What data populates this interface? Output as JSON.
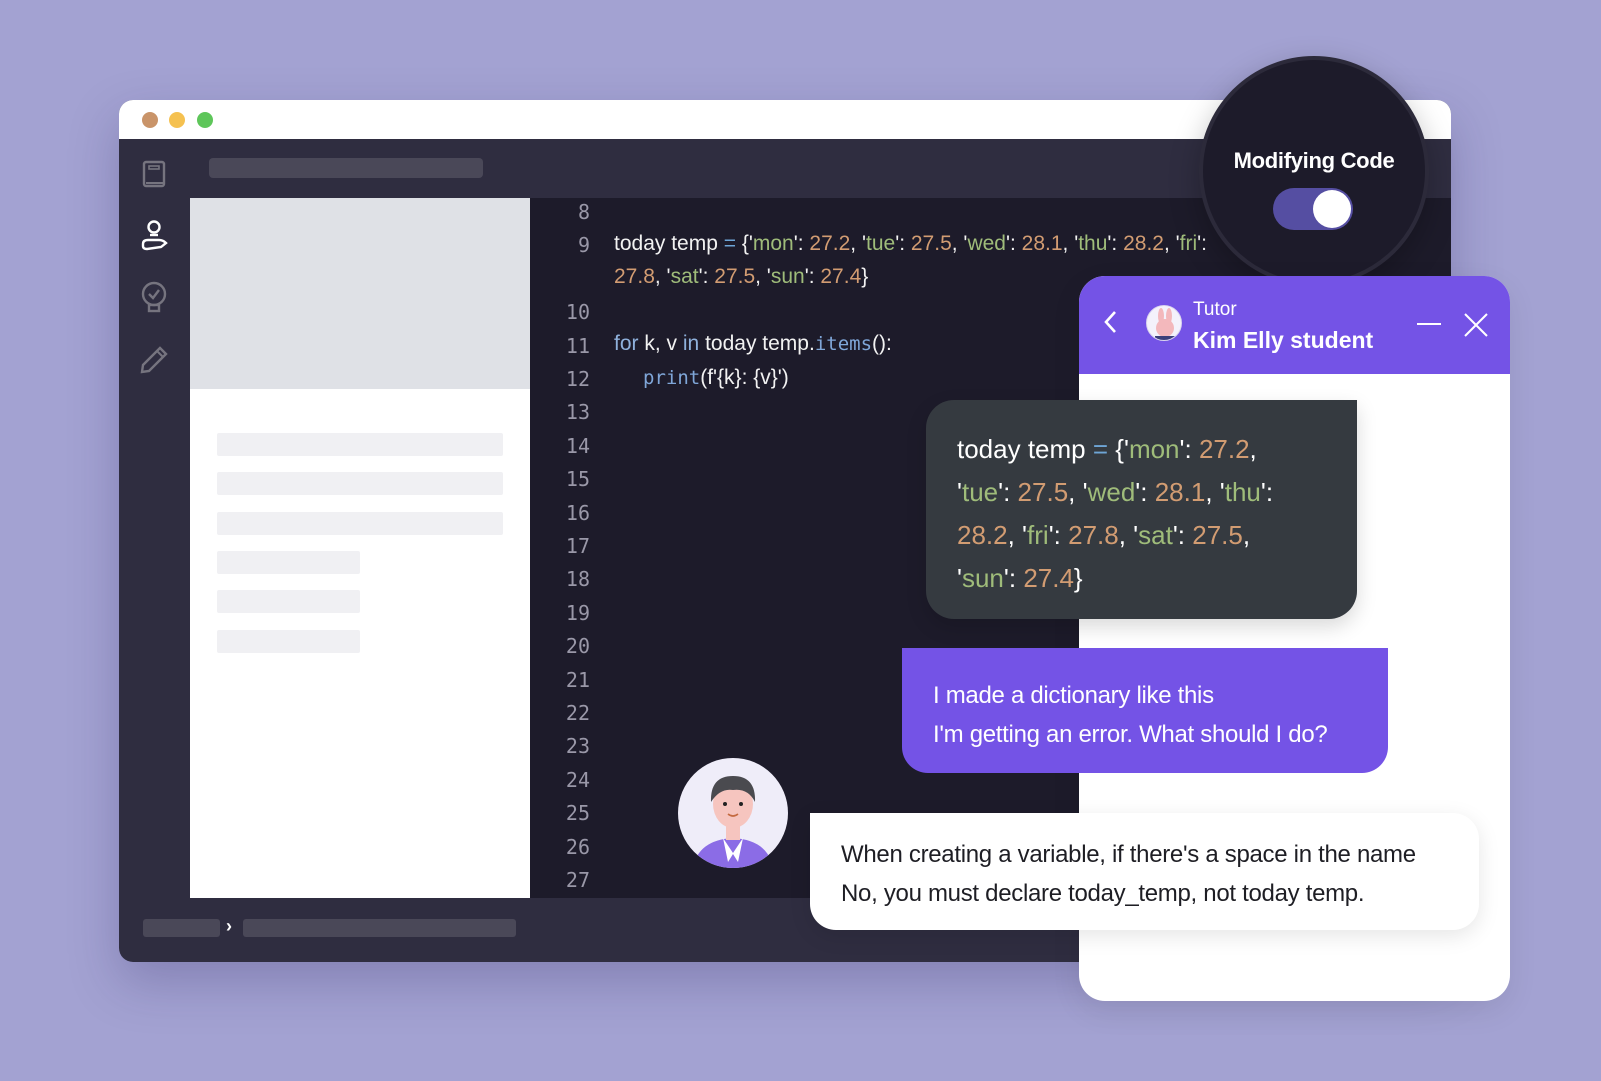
{
  "window": {
    "controls": [
      "close",
      "minimize",
      "maximize"
    ],
    "colors": {
      "close": "#c99469",
      "minimize": "#f5c150",
      "maximize": "#5ec65a"
    }
  },
  "sidebar": {
    "items": [
      {
        "icon": "book-icon",
        "active": false
      },
      {
        "icon": "lightbulb-hand-icon",
        "active": true
      },
      {
        "icon": "lightbulb-check-icon",
        "active": false
      },
      {
        "icon": "pencil-icon",
        "active": false
      }
    ]
  },
  "editor": {
    "lines": [
      {
        "num": "8"
      },
      {
        "num": "9"
      },
      {
        "num": ""
      },
      {
        "num": "10"
      },
      {
        "num": "11"
      },
      {
        "num": "12"
      },
      {
        "num": "13"
      },
      {
        "num": "14"
      },
      {
        "num": "15"
      },
      {
        "num": "16"
      },
      {
        "num": "17"
      },
      {
        "num": "18"
      },
      {
        "num": "19"
      },
      {
        "num": "20"
      },
      {
        "num": "21"
      },
      {
        "num": "22"
      },
      {
        "num": "23"
      },
      {
        "num": "24"
      },
      {
        "num": "25"
      },
      {
        "num": "26"
      },
      {
        "num": "27"
      }
    ],
    "code": {
      "var": "today temp",
      "eq": "=",
      "days": [
        {
          "key": "mon",
          "val": "27.2"
        },
        {
          "key": "tue",
          "val": "27.5"
        },
        {
          "key": "wed",
          "val": "28.1"
        },
        {
          "key": "thu",
          "val": "28.2"
        },
        {
          "key": "fri",
          "val": "27.8"
        },
        {
          "key": "sat",
          "val": "27.5"
        },
        {
          "key": "sun",
          "val": "27.4"
        }
      ],
      "for_kw": "for",
      "loop_vars": "k, v",
      "in_kw": "in",
      "loop_target": "today temp.",
      "items_fn": "items",
      "loop_end": "():",
      "print_fn": "print",
      "print_args": "(f'{k}: {v}')"
    }
  },
  "mode_toggle": {
    "label": "Modifying Code",
    "on": true,
    "color": "#554ea2"
  },
  "chat": {
    "header": {
      "role": "Tutor",
      "name": "Kim Elly student",
      "color": "#7453e6"
    },
    "messages": [
      {
        "type": "code",
        "lines": [
          "today temp = {'mon': 27.2,",
          "'tue': 27.5, 'wed': 28.1, 'thu':",
          "28.2, 'fri': 27.8, 'sat': 27.5,",
          "'sun': 27.4}"
        ]
      },
      {
        "type": "user",
        "lines": [
          "I made a dictionary like this",
          "I'm getting an error. What should I do?"
        ]
      },
      {
        "type": "tutor",
        "lines": [
          "When creating a variable, if there's a space in the name",
          "No, you must declare today_temp, not today temp."
        ]
      }
    ]
  }
}
